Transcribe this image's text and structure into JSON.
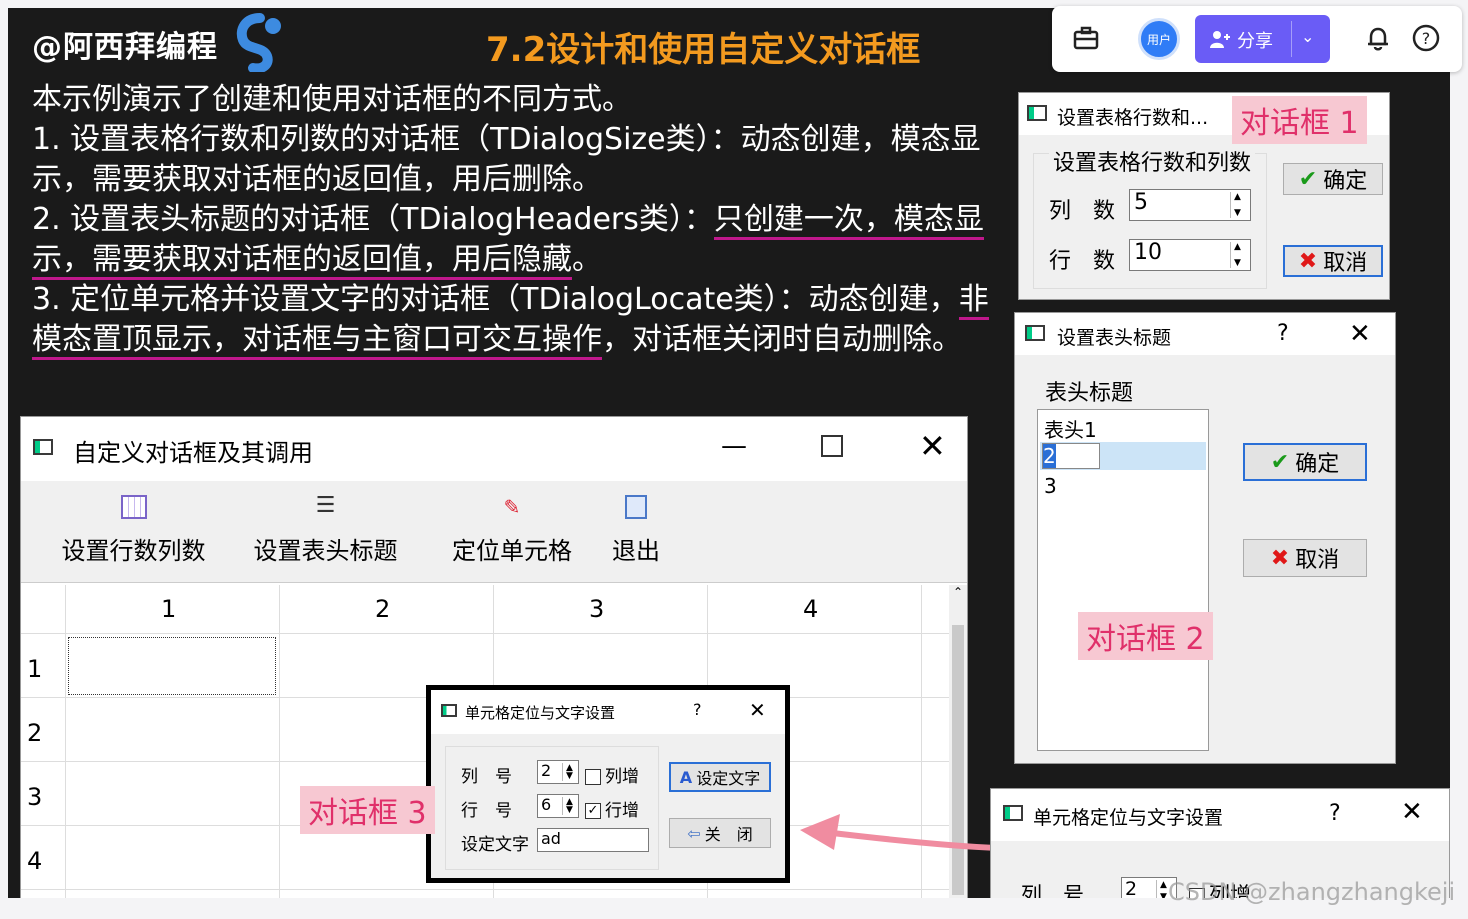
{
  "slide": {
    "brand": "@阿西拜编程",
    "title": "7.2设计和使用自定义对话框",
    "intro": "本示例演示了创建和使用对话框的不同方式。",
    "item1": "1. 设置表格行数和列数的对话框（TDialogSize类）：动态创建，模态显示，需要获取对话框的返回值，用后删除。",
    "item2_a": "2. 设置表头标题的对话框（TDialogHeaders类）：",
    "item2_b": "只创建一次，模态",
    "item2_c": "显示，需要获取对话框的返回值，用后隐藏",
    "item2_d": "。",
    "item3_a": "3. 定位单元格并设置文字的对话框（TDialogLocate类）：动态创建，",
    "item3_b": "非模态置顶显示，对话框与主窗口可交互操作",
    "item3_c": "，对话框关闭时自动删除。"
  },
  "topbar": {
    "avatar_text": "用户",
    "share_label": "分享",
    "icons": [
      "briefcase-icon",
      "share-user-icon",
      "chevron-down-icon",
      "bell-icon",
      "help-icon"
    ]
  },
  "main_window": {
    "title": "自定义对话框及其调用",
    "toolbar": [
      "设置行数列数",
      "设置表头标题",
      "定位单元格",
      "退出"
    ],
    "col_headers": [
      "1",
      "2",
      "3",
      "4"
    ],
    "row_headers": [
      "1",
      "2",
      "3",
      "4"
    ]
  },
  "dialog1": {
    "title": "设置表格行数和...",
    "tag": "对话框 1",
    "group_title": "设置表格行数和列数",
    "col_label": "列　数",
    "col_value": "5",
    "row_label": "行　数",
    "row_value": "10",
    "ok": "确定",
    "cancel": "取消"
  },
  "dialog2": {
    "title": "设置表头标题",
    "help": "?",
    "tag": "对话框 2",
    "group_title": "表头标题",
    "items": [
      "表头1",
      "2",
      "3"
    ],
    "ok": "确定",
    "cancel": "取消"
  },
  "dialog3": {
    "title": "单元格定位与文字设置",
    "help": "?",
    "tag": "对话框 3",
    "col_label": "列　号",
    "col_value": "2",
    "col_inc": "列增",
    "row_label": "行　号",
    "row_value": "6",
    "row_inc": "行增",
    "text_label": "设定文字",
    "text_value": "ad",
    "set_text": "设定文字",
    "close": "关　闭"
  },
  "dialog3_copy": {
    "title": "单元格定位与文字设置",
    "help": "?",
    "col_label": "列　号",
    "col_value": "2",
    "col_inc": "列增"
  },
  "watermark": "CSDN @zhangzhangkeji",
  "colors": {
    "accent_orange": "#f39a1f",
    "underline_magenta": "#c0188c",
    "tag_pink": "#f7c8d2",
    "tag_text": "#e0306a",
    "share_purple": "#6a5cf6"
  }
}
